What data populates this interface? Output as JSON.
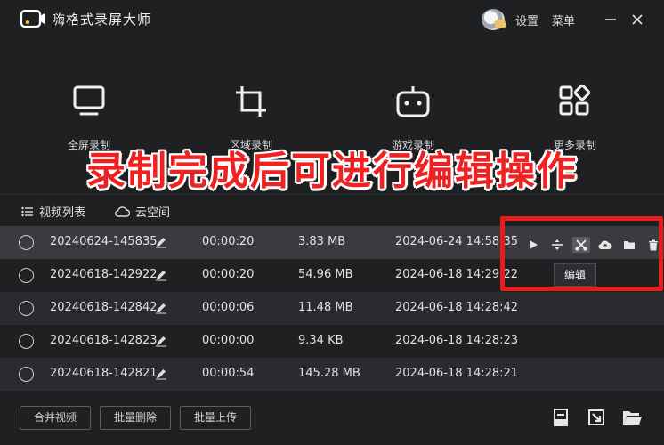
{
  "app": {
    "title": "嗨格式录屏大师"
  },
  "titlebar": {
    "settings_label": "设置",
    "menu_label": "菜单",
    "minimize_icon": "minimize-icon",
    "close_icon": "close-icon"
  },
  "modes": [
    {
      "label": "全屏录制",
      "icon": "monitor-icon"
    },
    {
      "label": "区域录制",
      "icon": "crop-icon"
    },
    {
      "label": "游戏录制",
      "icon": "gamepad-icon"
    },
    {
      "label": "更多录制",
      "icon": "apps-grid-icon"
    }
  ],
  "banner": {
    "text": "录制完成后可进行编辑操作",
    "color": "#ee2222"
  },
  "tabs": [
    {
      "label": "视频列表",
      "icon": "list-icon"
    },
    {
      "label": "云空间",
      "icon": "cloud-icon"
    }
  ],
  "recordings": [
    {
      "name": "20240624-145835",
      "duration": "00:00:20",
      "size": "3.83 MB",
      "date": "2024-06-24 14:58:35"
    },
    {
      "name": "20240618-142922",
      "duration": "00:00:20",
      "size": "54.96 MB",
      "date": "2024-06-18 14:29:22"
    },
    {
      "name": "20240618-142842",
      "duration": "00:00:06",
      "size": "11.48 MB",
      "date": "2024-06-18 14:28:42"
    },
    {
      "name": "20240618-142823",
      "duration": "00:00:00",
      "size": "9.34 KB",
      "date": "2024-06-18 14:28:23"
    },
    {
      "name": "20240618-142821",
      "duration": "00:00:54",
      "size": "145.28 MB",
      "date": "2024-06-18 14:28:21"
    }
  ],
  "row_actions": [
    "play-icon",
    "split-icon",
    "edit-scissors-icon",
    "cloud-upload-icon",
    "folder-icon",
    "trash-icon"
  ],
  "tooltip": {
    "text": "编辑"
  },
  "bottom": {
    "merge_label": "合并视频",
    "batch_delete_label": "批量删除",
    "batch_upload_label": "批量上传"
  },
  "colors": {
    "background": "#1f2022",
    "row_alt": "#2a2b2e",
    "highlight_frame": "#e81c1c"
  }
}
